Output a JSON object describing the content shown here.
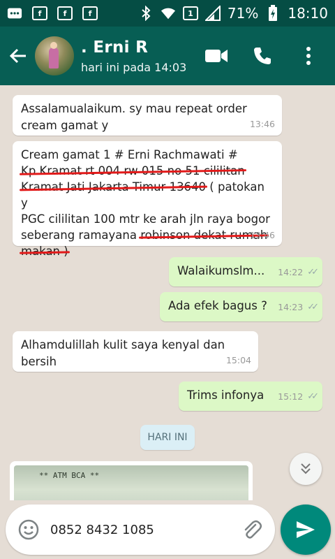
{
  "statusbar": {
    "battery": "71%",
    "time": "18:10",
    "sim_badge": "1"
  },
  "header": {
    "contact_name": ". Erni R",
    "contact_status": "hari ini pada 14:03"
  },
  "messages": [
    {
      "direction": "in",
      "lines": [
        "Assalamualaikum. sy mau repeat order",
        "cream gamat y"
      ],
      "time": "13:46"
    },
    {
      "direction": "in",
      "segments": [
        {
          "text": "Cream gamat 1 # Erni Rachmawati #",
          "struck": false
        },
        {
          "text": "Kp.Kramat rt 004 rw 015 no 51 cililitan",
          "struck": true
        },
        {
          "text": "Kramat Jati Jakarta Timur 13640",
          "struck": true
        },
        {
          "text": " ( patokan y",
          "struck": false
        },
        {
          "text": "PGC cililitan 100 mtr ke arah jln raya bogor",
          "struck": false
        },
        {
          "text": "seberang ramayana ",
          "struck": false
        },
        {
          "text": "robinson dekat rumah",
          "struck": true
        },
        {
          "text": "makan )",
          "struck": true
        }
      ],
      "time": "13:46"
    },
    {
      "direction": "out",
      "text": "Walaikumslm...",
      "time": "14:22"
    },
    {
      "direction": "out",
      "text": "Ada efek bagus ?",
      "time": "14:23"
    },
    {
      "direction": "in",
      "text": "Alhamdulillah kulit saya kenyal dan bersih",
      "time": "15:04"
    },
    {
      "direction": "out",
      "text": "Trims infonya",
      "time": "15:12"
    }
  ],
  "date_divider": "HARI INI",
  "image_preview_text": "**    ATM BCA    **",
  "composer": {
    "value": "0852 8432 1085"
  },
  "colors": {
    "header": "#075e54",
    "statusbar": "#054d44",
    "chat_bg": "#e5ddd5",
    "outgoing": "#dcf8c6",
    "send": "#00897b",
    "strike": "#e21a1a"
  }
}
